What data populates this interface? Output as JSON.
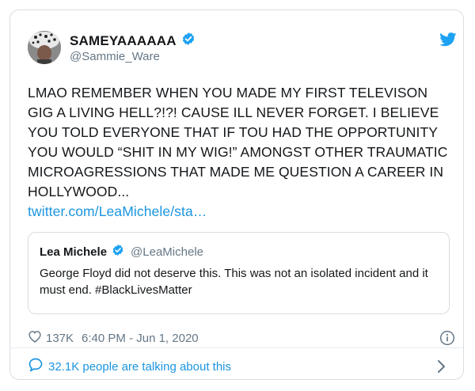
{
  "tweet": {
    "display_name": "SAMEYAAAAAA",
    "handle": "@Sammie_Ware",
    "text": "LMAO REMEMBER WHEN YOU MADE MY FIRST TELEVISON GIG A LIVING HELL?!?! CAUSE ILL NEVER FORGET. I BELIEVE YOU TOLD EVERYONE THAT IF TOU HAD THE OPPORTUNITY YOU WOULD “SHIT IN MY WIG!” AMONGST OTHER TRAUMATIC MICROAGRESSIONS THAT MADE ME QUESTION A CAREER IN HOLLYWOOD...",
    "link": "twitter.com/LeaMichele/sta…",
    "likes": "137K",
    "timestamp": "6:40 PM - Jun 1, 2020",
    "talking": "32.1K people are talking about this"
  },
  "quoted": {
    "display_name": "Lea Michele",
    "handle": "@LeaMichele",
    "text": "George Floyd did not deserve this. This was not an isolated incident and it must end. #BlackLivesMatter"
  },
  "colors": {
    "accent": "#1da1f2",
    "link": "#1b95e0",
    "muted": "#657786",
    "text": "#14171a",
    "border": "#d9dde1"
  },
  "icons": [
    "avatar",
    "verified-badge-icon",
    "twitter-bird-icon",
    "heart-icon",
    "info-icon",
    "comment-icon",
    "chevron-right-icon"
  ]
}
